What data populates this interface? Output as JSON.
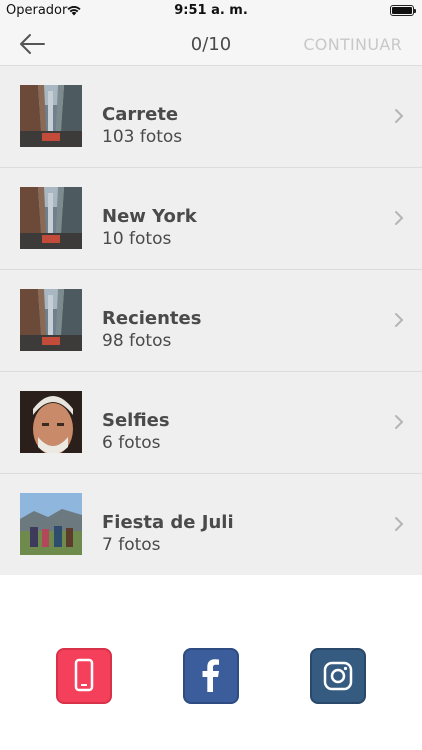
{
  "status_bar": {
    "carrier": "Operador",
    "time": "9:51 a. m."
  },
  "nav": {
    "back_icon": "arrow-left-icon",
    "title": "0/10",
    "continue_label": "CONTINUAR"
  },
  "albums": [
    {
      "name": "Carrete",
      "count": "103 fotos",
      "thumb": "city-street-photo"
    },
    {
      "name": "New York",
      "count": "10 fotos",
      "thumb": "city-street-photo"
    },
    {
      "name": "Recientes",
      "count": "98 fotos",
      "thumb": "city-street-photo"
    },
    {
      "name": "Selfies",
      "count": "6 fotos",
      "thumb": "portrait-photo"
    },
    {
      "name": "Fiesta de Juli",
      "count": "7 fotos",
      "thumb": "outdoor-group-photo"
    }
  ],
  "sources": [
    {
      "icon": "phone-icon",
      "color": "#f5405c"
    },
    {
      "icon": "facebook-icon",
      "color": "#3c5d9b"
    },
    {
      "icon": "instagram-icon",
      "color": "#355b80"
    }
  ]
}
